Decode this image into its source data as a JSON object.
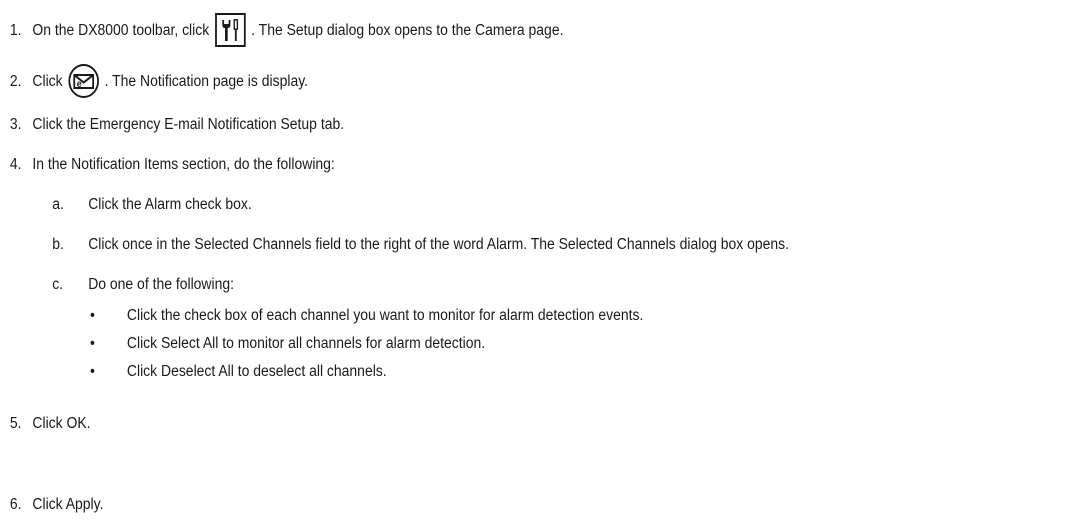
{
  "steps": [
    {
      "num": "1.",
      "before": "On the DX8000 toolbar, click",
      "icon": "setup-tools-icon",
      "after": ". The Setup dialog box opens to the Camera page."
    },
    {
      "num": "2.",
      "before": "Click",
      "icon": "email-notification-icon",
      "after": ". The Notification page is display."
    },
    {
      "num": "3.",
      "text": "Click the Emergency E-mail Notification Setup tab."
    },
    {
      "num": "4.",
      "text": "In the Notification Items section, do the following:",
      "substeps": [
        {
          "num": "a.",
          "text": "Click the Alarm check box."
        },
        {
          "num": "b.",
          "text": "Click once in the Selected Channels field to the right of the word Alarm. The Selected Channels dialog box opens."
        },
        {
          "num": "c.",
          "text": "Do one of the following:",
          "bullets": [
            {
              "mark": "•",
              "text": "Click the check box of each channel you want to monitor for alarm detection events."
            },
            {
              "mark": "•",
              "text": "Click Select All to monitor all channels for alarm detection."
            },
            {
              "mark": "•",
              "text": "Click Deselect All to deselect all channels."
            }
          ]
        }
      ]
    },
    {
      "num": "5.",
      "text": "Click OK."
    },
    {
      "num": "6.",
      "text": "Click Apply."
    }
  ]
}
